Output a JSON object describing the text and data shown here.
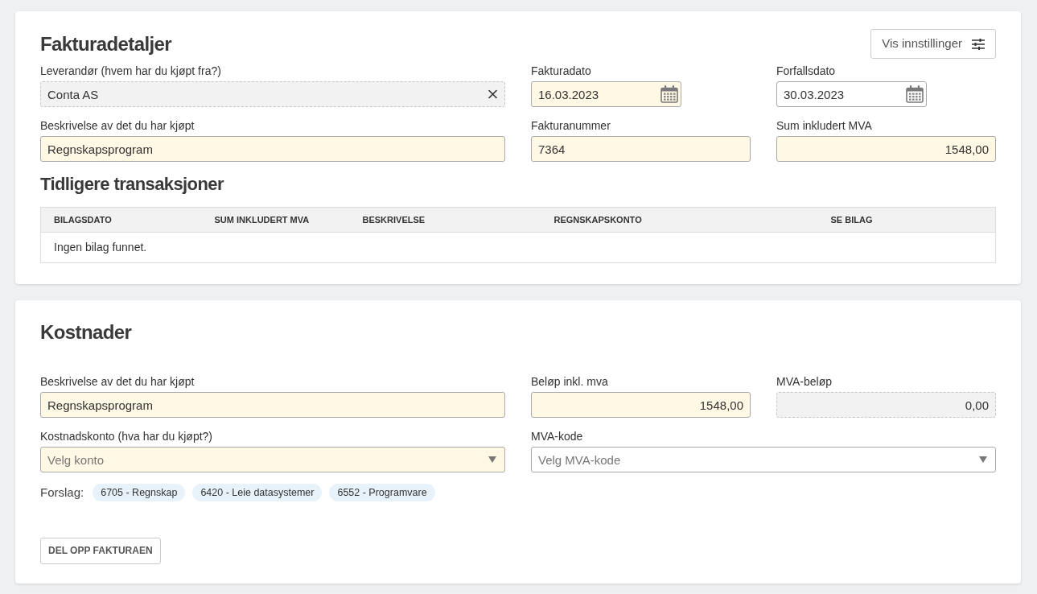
{
  "invoice_details": {
    "title": "Fakturadetaljer",
    "settings_button": "Vis innstillinger",
    "field_rows": [
      [
        {
          "label": "Leverandør (hvem har du kjøpt fra?)",
          "kind": "lookup",
          "value": "Conta AS",
          "highlighted": false,
          "disabled": true
        },
        {
          "label": "Fakturadato",
          "kind": "date",
          "value": "16.03.2023",
          "highlighted": true,
          "disabled": false
        },
        {
          "label": "Forfallsdato",
          "kind": "date",
          "value": "30.03.2023",
          "highlighted": false,
          "disabled": false
        }
      ],
      [
        {
          "label": "Beskrivelse av det du har kjøpt",
          "kind": "text",
          "value": "Regnskapsprogram",
          "highlighted": true,
          "disabled": false
        },
        {
          "label": "Fakturanummer",
          "kind": "text",
          "value": "7364",
          "highlighted": true,
          "disabled": false
        },
        {
          "label": "Sum inkludert MVA",
          "kind": "amount",
          "value": "1548,00",
          "highlighted": true,
          "disabled": false
        }
      ]
    ],
    "history": {
      "title": "Tidligere transaksjoner",
      "columns": [
        "BILAGSDATO",
        "SUM INKLUDERT MVA",
        "BESKRIVELSE",
        "REGNSKAPSKONTO",
        "SE BILAG"
      ],
      "empty_message": "Ingen bilag funnet."
    }
  },
  "costs": {
    "title": "Kostnader",
    "field_rows": [
      [
        {
          "label": "Beskrivelse av det du har kjøpt",
          "kind": "text",
          "value": "Regnskapsprogram",
          "highlighted": true,
          "disabled": false
        },
        {
          "label": "Beløp inkl. mva",
          "kind": "amount",
          "value": "1548,00",
          "highlighted": true,
          "disabled": false
        },
        {
          "label": "MVA-beløp",
          "kind": "amount",
          "value": "0,00",
          "highlighted": false,
          "disabled": true
        }
      ],
      [
        {
          "label": "Kostnadskonto (hva har du kjøpt?)",
          "kind": "select",
          "placeholder": "Velg konto",
          "highlighted": true,
          "disabled": false
        },
        {
          "label": "MVA-kode",
          "kind": "select",
          "placeholder": "Velg MVA-kode",
          "highlighted": false,
          "disabled": false
        }
      ]
    ],
    "suggestions": {
      "label": "Forslag:",
      "items": [
        "6705 - Regnskap",
        "6420 - Leie datasystemer",
        "6552 - Programvare"
      ]
    },
    "split_button": "DEL OPP FAKTURAEN"
  }
}
